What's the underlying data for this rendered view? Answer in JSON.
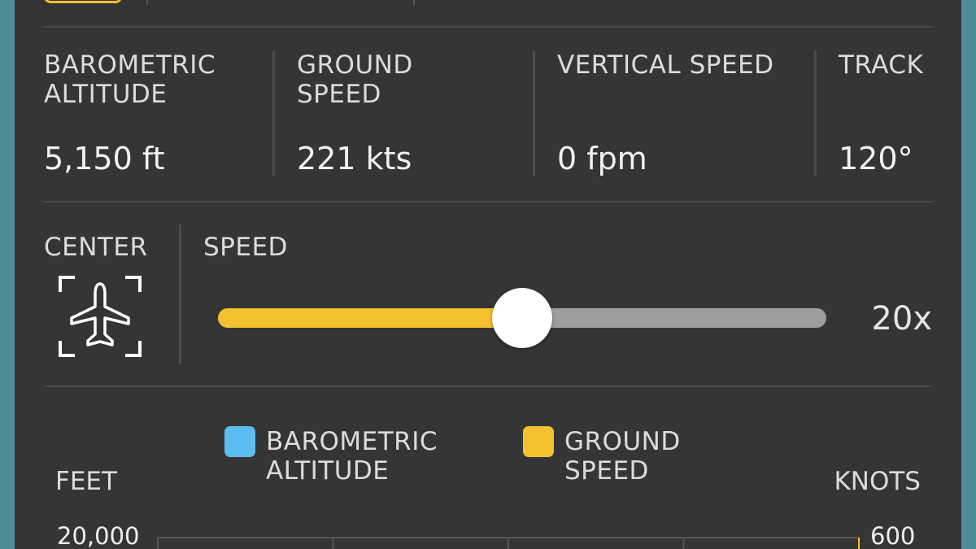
{
  "stats": {
    "barometric_altitude": {
      "label": "BAROMETRIC\nALTITUDE",
      "value": "5,150 ft"
    },
    "ground_speed": {
      "label": "GROUND\nSPEED",
      "value": "221 kts"
    },
    "vertical_speed": {
      "label": "VERTICAL SPEED",
      "value": "0 fpm"
    },
    "track": {
      "label": "TRACK",
      "value": "120°"
    }
  },
  "controls": {
    "center_label": "CENTER",
    "center_icon": "airplane-center-icon",
    "speed_label": "SPEED",
    "speed_value": "20x",
    "speed_fraction": 0.5,
    "colors": {
      "fill": "#f5c12e",
      "track": "#9d9d9d",
      "thumb": "#ffffff"
    }
  },
  "chart": {
    "left_axis_label": "FEET",
    "right_axis_label": "KNOTS",
    "left_top_tick": "20,000",
    "right_top_tick": "600",
    "legend": [
      {
        "label": "BAROMETRIC\nALTITUDE",
        "color": "#5bbdf0"
      },
      {
        "label": "GROUND\nSPEED",
        "color": "#f5c12e"
      }
    ]
  },
  "chart_data": {
    "type": "line",
    "series": [
      {
        "name": "BAROMETRIC ALTITUDE",
        "values": []
      },
      {
        "name": "GROUND SPEED",
        "values": []
      }
    ],
    "ylabel": "FEET",
    "y2label": "KNOTS",
    "yticks": [
      "20,000"
    ],
    "y2ticks": [
      "600"
    ],
    "legend_position": "top"
  }
}
